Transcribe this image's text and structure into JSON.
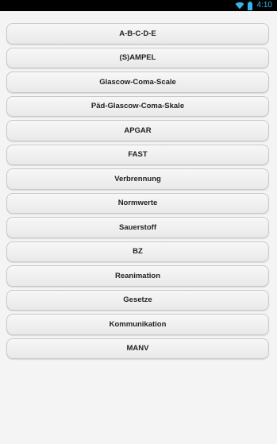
{
  "status_bar": {
    "time": "4:10",
    "icons": [
      "wifi-icon",
      "battery-icon"
    ],
    "accent_color": "#33b5e5"
  },
  "menu": {
    "items": [
      "A-B-C-D-E",
      "(S)AMPEL",
      "Glascow-Coma-Scale",
      "Päd-Glascow-Coma-Skale",
      "APGAR",
      "FAST",
      "Verbrennung",
      "Normwerte",
      "Sauerstoff",
      "BZ",
      "Reanimation",
      "Gesetze",
      "Kommunikation",
      "MANV"
    ]
  }
}
